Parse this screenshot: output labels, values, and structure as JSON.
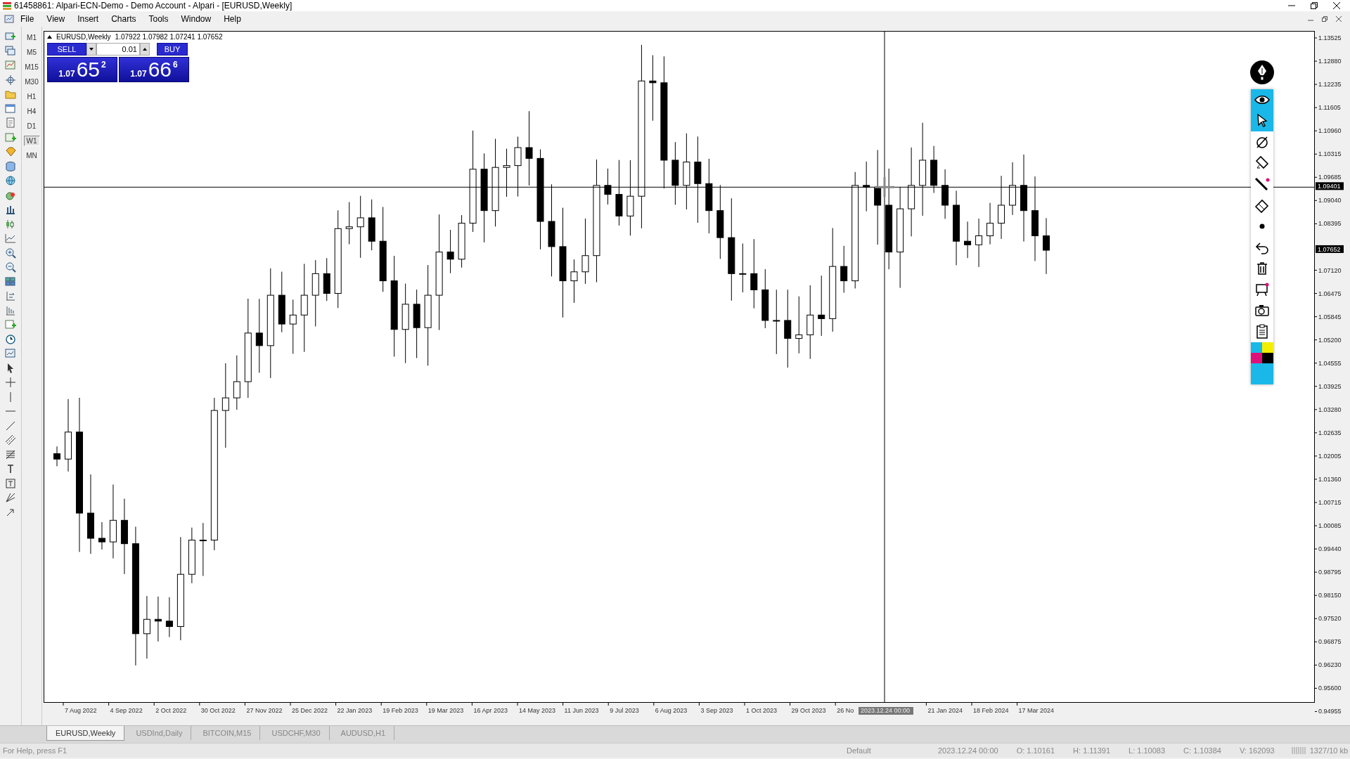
{
  "window": {
    "title": "61458861: Alpari-ECN-Demo - Demo Account - Alpari - [EURUSD,Weekly]"
  },
  "menu": [
    "File",
    "View",
    "Insert",
    "Charts",
    "Tools",
    "Window",
    "Help"
  ],
  "timeframes": [
    {
      "label": "M1",
      "selected": false
    },
    {
      "label": "M5",
      "selected": false
    },
    {
      "label": "M15",
      "selected": false
    },
    {
      "label": "M30",
      "selected": false
    },
    {
      "label": "H1",
      "selected": false
    },
    {
      "label": "H4",
      "selected": false
    },
    {
      "label": "D1",
      "selected": false
    },
    {
      "label": "W1",
      "selected": true
    },
    {
      "label": "MN",
      "selected": false
    }
  ],
  "chart": {
    "symbol": "EURUSD,Weekly",
    "ohlc": "1.07922 1.07982 1.07241 1.07652",
    "trade_panel": {
      "sell_label": "SELL",
      "buy_label": "BUY",
      "volume": "0.01",
      "sell_price": {
        "prefix": "1.07",
        "big": "65",
        "sup": "2"
      },
      "buy_price": {
        "prefix": "1.07",
        "big": "66",
        "sup": "6"
      }
    },
    "price_axis": [
      "1.13525",
      "1.12880",
      "1.12235",
      "1.11605",
      "1.10960",
      "1.10315",
      "1.09685",
      "1.09040",
      "1.08395",
      "1.07120",
      "1.06475",
      "1.05845",
      "1.05200",
      "1.04555",
      "1.03925",
      "1.03280",
      "1.02635",
      "1.02005",
      "1.01360",
      "1.00715",
      "1.00085",
      "0.99440",
      "0.98795",
      "0.98150",
      "0.97520",
      "0.96875",
      "0.96230",
      "0.95600",
      "0.94955"
    ],
    "price_line_label": "1.09401",
    "bid_label": "1.07652",
    "time_axis": [
      "7 Aug 2022",
      "4 Sep 2022",
      "2 Oct 2022",
      "30 Oct 2022",
      "27 Nov 2022",
      "25 Dec 2022",
      "22 Jan 2023",
      "19 Feb 2023",
      "19 Mar 2023",
      "16 Apr 2023",
      "14 May 2023",
      "11 Jun 2023",
      "9 Jul 2023",
      "6 Aug 2023",
      "3 Sep 2023",
      "1 Oct 2023",
      "29 Oct 2023",
      "26 No",
      "21 Jan 2024",
      "18 Feb 2024",
      "17 Mar 2024"
    ],
    "crosshair_time": "2023.12.24 00:00"
  },
  "drawing_toolbar": {
    "tools": [
      {
        "kind": "eye",
        "selected": true
      },
      {
        "kind": "pointer",
        "selected": true
      },
      {
        "kind": "spotlight",
        "selected": false
      },
      {
        "kind": "highlighter",
        "selected": false
      },
      {
        "kind": "pen",
        "selected": false
      },
      {
        "kind": "eraser",
        "selected": false
      },
      {
        "kind": "dot",
        "selected": false
      },
      {
        "kind": "undo",
        "selected": false
      },
      {
        "kind": "trash",
        "selected": false
      },
      {
        "kind": "board",
        "selected": false
      },
      {
        "kind": "camera",
        "selected": false
      },
      {
        "kind": "clipboard",
        "selected": false
      }
    ],
    "palette": [
      {
        "color": "#1ab8e8"
      },
      {
        "color": "#f4ee00"
      },
      {
        "color": "#e0107a"
      },
      {
        "color": "#000000"
      },
      {
        "color": "#1ab8e8"
      }
    ]
  },
  "tabs": [
    {
      "label": "EURUSD,Weekly",
      "selected": true
    },
    {
      "label": "USDInd,Daily",
      "selected": false
    },
    {
      "label": "BITCOIN,M15",
      "selected": false
    },
    {
      "label": "USDCHF,M30",
      "selected": false
    },
    {
      "label": "AUDUSD,H1",
      "selected": false
    }
  ],
  "status": {
    "help": "For Help, press F1",
    "profile": "Default",
    "time": "2023.12.24 00:00",
    "open": "O: 1.10161",
    "high": "H: 1.11391",
    "low": "L: 1.10083",
    "close": "C: 1.10384",
    "volume": "V: 162093",
    "traffic": "1327/10 kb"
  }
}
